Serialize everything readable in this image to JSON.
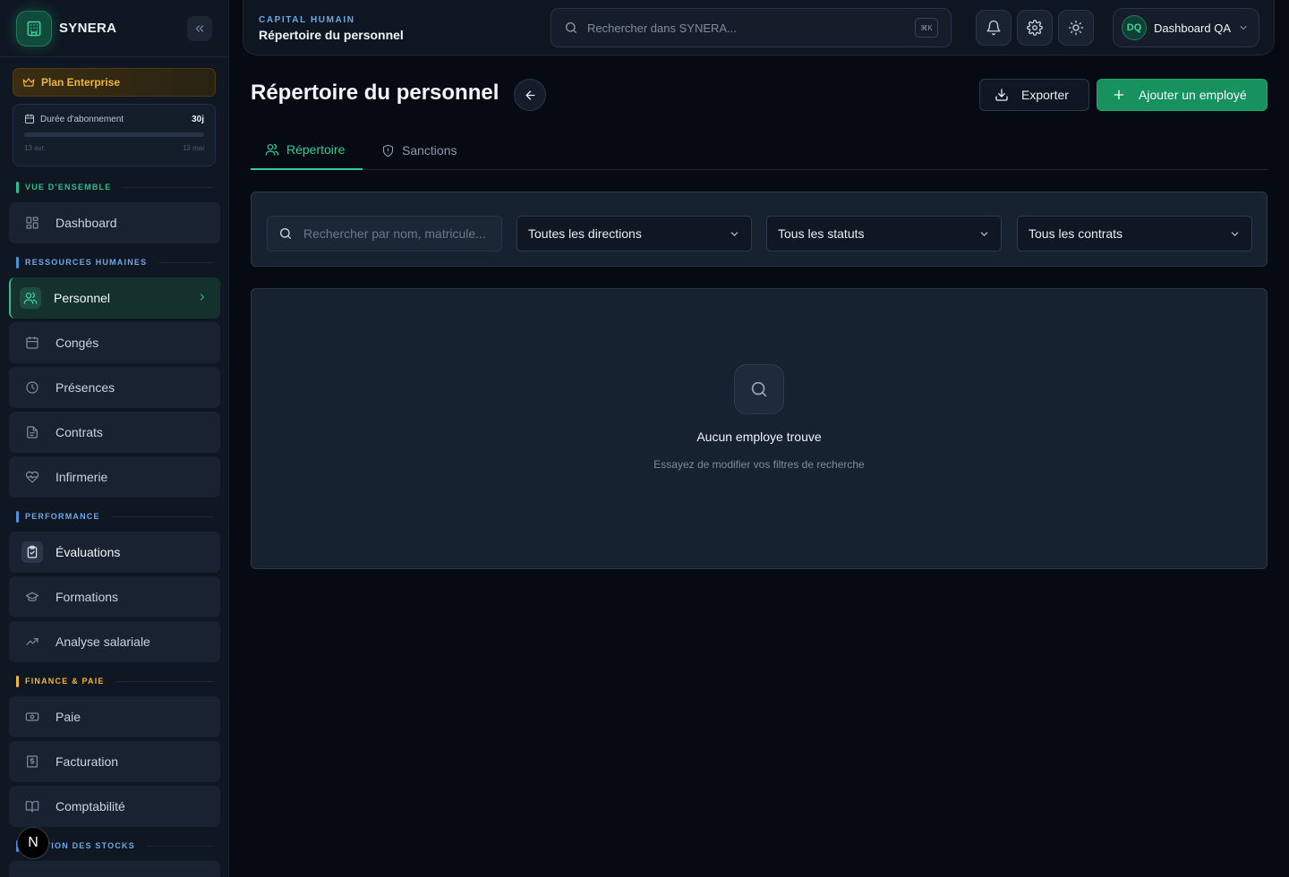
{
  "brand": {
    "name": "SYNERA"
  },
  "plan": {
    "label": "Plan Enterprise"
  },
  "subscription": {
    "label": "Durée d'abonnement",
    "days": "30j",
    "start": "13 avr.",
    "end": "13 mai",
    "progress": 0
  },
  "sidebar": {
    "sections": [
      {
        "label": "VUE D'ENSEMBLE",
        "color": "#2fbf8c"
      },
      {
        "label": "RESSOURCES HUMAINES",
        "color": "#4e8fe0"
      },
      {
        "label": "PERFORMANCE",
        "color": "#4e8fe0"
      },
      {
        "label": "FINANCE & PAIE",
        "color": "#f1b53b"
      },
      {
        "label": "GESTION DES STOCKS",
        "color": "#4e8fe0"
      }
    ],
    "items": [
      {
        "label": "Dashboard",
        "icon": "grid-icon"
      },
      {
        "label": "Personnel",
        "icon": "users-icon",
        "active": true
      },
      {
        "label": "Congés",
        "icon": "calendar-icon"
      },
      {
        "label": "Présences",
        "icon": "clock-icon"
      },
      {
        "label": "Contrats",
        "icon": "file-icon"
      },
      {
        "label": "Infirmerie",
        "icon": "heart-pulse-icon"
      },
      {
        "label": "Évaluations",
        "icon": "clipboard-check-icon"
      },
      {
        "label": "Formations",
        "icon": "graduation-cap-icon"
      },
      {
        "label": "Analyse salariale",
        "icon": "trending-up-icon"
      },
      {
        "label": "Paie",
        "icon": "banknote-icon"
      },
      {
        "label": "Facturation",
        "icon": "receipt-icon"
      },
      {
        "label": "Comptabilité",
        "icon": "book-icon"
      }
    ],
    "n_badge": "N"
  },
  "topbar": {
    "breadcrumb_section": "CAPITAL HUMAIN",
    "breadcrumb_title": "Répertoire du personnel",
    "search_placeholder": "Rechercher dans SYNERA...",
    "search_shortcut": "⌘K",
    "user_initials": "DQ",
    "user_name": "Dashboard QA"
  },
  "page": {
    "title": "Répertoire du personnel",
    "export_label": "Exporter",
    "add_label": "Ajouter un employé",
    "tabs": [
      {
        "label": "Répertoire",
        "active": true
      },
      {
        "label": "Sanctions",
        "active": false
      }
    ]
  },
  "filters": {
    "search_placeholder": "Rechercher par nom, matricule...",
    "direction": "Toutes les directions",
    "status": "Tous les statuts",
    "contract": "Tous les contrats"
  },
  "empty_state": {
    "title": "Aucun employe trouve",
    "subtitle": "Essayez de modifier vos filtres de recherche"
  },
  "colors": {
    "accent": "#2fcf95",
    "primary_button": "#17925f",
    "warning": "#f1b53b"
  }
}
